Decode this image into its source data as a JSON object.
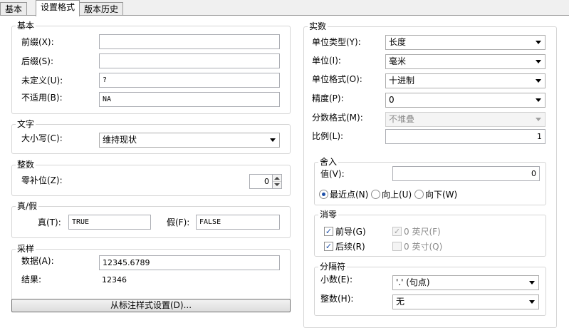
{
  "tabs": [
    {
      "label": "基本"
    },
    {
      "label": "设置格式"
    },
    {
      "label": "版本历史"
    }
  ],
  "basic": {
    "title": "基本",
    "prefix_label": "前缀(X):",
    "prefix_value": "",
    "suffix_label": "后缀(S):",
    "suffix_value": "",
    "undefined_label": "未定义(U):",
    "undefined_value": "?",
    "na_label": "不适用(B):",
    "na_value": "NA"
  },
  "text": {
    "title": "文字",
    "case_label": "大小写(C):",
    "case_value": "维持现状"
  },
  "integer": {
    "title": "整数",
    "zero_pad_label": "零补位(Z):",
    "zero_pad_value": "0"
  },
  "truefalse": {
    "title": "真/假",
    "true_label": "真(T):",
    "true_value": "TRUE",
    "false_label": "假(F):",
    "false_value": "FALSE"
  },
  "sample": {
    "title": "采样",
    "data_label": "数据(A):",
    "data_value": "12345.6789",
    "result_label": "结果:",
    "result_value": "12346"
  },
  "from_dim_button": "从标注样式设置(D)...",
  "real": {
    "title": "实数",
    "unit_type_label": "单位类型(Y):",
    "unit_type_value": "长度",
    "unit_label": "单位(I):",
    "unit_value": "毫米",
    "unit_format_label": "单位格式(O):",
    "unit_format_value": "十进制",
    "precision_label": "精度(P):",
    "precision_value": "0",
    "fraction_label": "分数格式(M):",
    "fraction_value": "不堆叠",
    "scale_label": "比例(L):",
    "scale_value": "1"
  },
  "rounding": {
    "title": "舍入",
    "value_label": "值(V):",
    "value": "0",
    "nearest_label": "最近点(N)",
    "up_label": "向上(U)",
    "down_label": "向下(W)",
    "selected": "nearest"
  },
  "zero_suppression": {
    "title": "消零",
    "leading_label": "前导(G)",
    "leading_checked": true,
    "trailing_label": "后续(R)",
    "trailing_checked": true,
    "feet_label": "0 英尺(F)",
    "feet_checked": true,
    "feet_disabled": true,
    "inch_label": "0 英寸(Q)",
    "inch_checked": false,
    "inch_disabled": true
  },
  "separator": {
    "title": "分隔符",
    "decimal_label": "小数(E):",
    "decimal_value": "'.' (句点)",
    "integer_label": "整数(H):",
    "integer_value": "无"
  }
}
